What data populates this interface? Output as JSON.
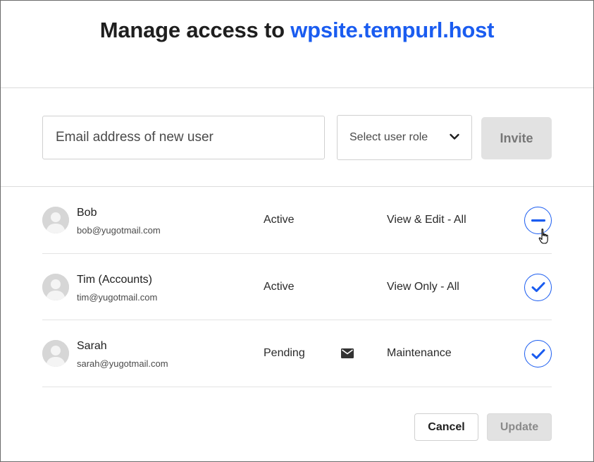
{
  "dialog": {
    "title_prefix": "Manage access to ",
    "title_domain": "wpsite.tempurl.host"
  },
  "invite": {
    "email_placeholder": "Email address of new user",
    "role_placeholder": "Select user role",
    "invite_label": "Invite"
  },
  "users": [
    {
      "name": "Bob",
      "email": "bob@yugotmail.com",
      "status": "Active",
      "role": "View & Edit - All",
      "action_icon": "minus-circle-icon",
      "pending_mail": false
    },
    {
      "name": "Tim (Accounts)",
      "email": "tim@yugotmail.com",
      "status": "Active",
      "role": "View Only - All",
      "action_icon": "check-circle-icon",
      "pending_mail": false
    },
    {
      "name": "Sarah",
      "email": "sarah@yugotmail.com",
      "status": "Pending",
      "role": "Maintenance",
      "action_icon": "check-circle-icon",
      "pending_mail": true
    }
  ],
  "footer": {
    "cancel_label": "Cancel",
    "update_label": "Update"
  },
  "colors": {
    "accent": "#1a5cf0",
    "disabled_bg": "#e2e2e2"
  }
}
